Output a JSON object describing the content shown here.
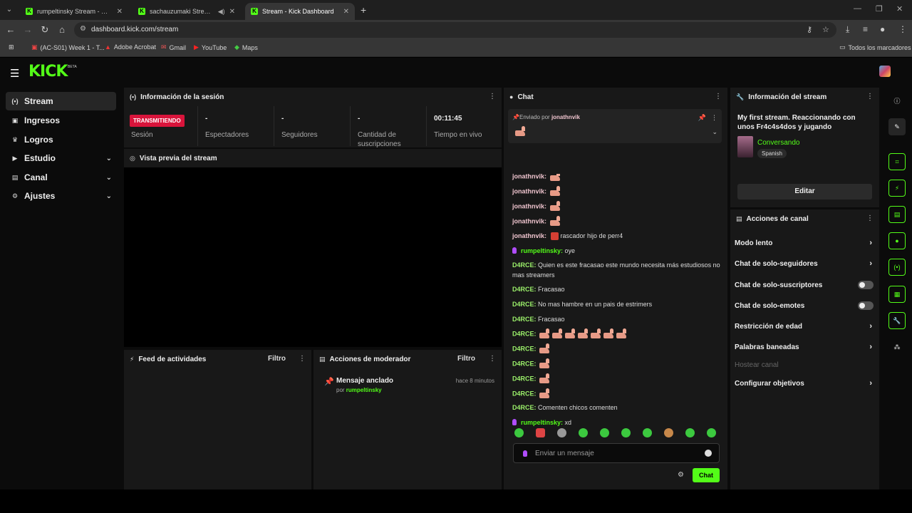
{
  "browser": {
    "tabs": [
      {
        "title": "rumpeltinsky Stream - Watch Li",
        "active": false
      },
      {
        "title": "sachauzumaki Stream - Wat",
        "active": false
      },
      {
        "title": "Stream - Kick Dashboard",
        "active": true
      }
    ],
    "url": "dashboard.kick.com/stream",
    "bookmarks": [
      "(AC-S01) Week 1 - T...",
      "Adobe Acrobat",
      "Gmail",
      "YouTube",
      "Maps"
    ],
    "all_bookmarks": "Todos los marcadores"
  },
  "app": {
    "logo": "KICK",
    "beta": "BETA",
    "sidebar": [
      {
        "label": "Stream",
        "icon": "broadcast-icon",
        "active": true,
        "chevron": false
      },
      {
        "label": "Ingresos",
        "icon": "wallet-icon",
        "active": false,
        "chevron": false
      },
      {
        "label": "Logros",
        "icon": "trophy-icon",
        "active": false,
        "chevron": false
      },
      {
        "label": "Estudio",
        "icon": "camera-icon",
        "active": false,
        "chevron": true
      },
      {
        "label": "Canal",
        "icon": "channel-icon",
        "active": false,
        "chevron": true
      },
      {
        "label": "Ajustes",
        "icon": "gear-icon",
        "active": false,
        "chevron": true
      }
    ],
    "session": {
      "title": "Información de la sesión",
      "live_badge": "TRANSMITIENDO",
      "session_label": "Sesión",
      "stats": [
        {
          "value": "-",
          "label": "Espectadores"
        },
        {
          "value": "-",
          "label": "Seguidores"
        },
        {
          "value": "-",
          "label": "Cantidad de suscripciones"
        },
        {
          "value": "00:11:45",
          "label": "Tiempo en vivo"
        }
      ]
    },
    "preview": {
      "title": "Vista previa del stream"
    },
    "activity": {
      "title": "Feed de actividades",
      "filter": "Filtro"
    },
    "mod": {
      "title": "Acciones de moderador",
      "filter": "Filtro",
      "item_title": "Mensaje anclado",
      "item_by_prefix": "por",
      "item_by_user": "rumpeltinsky",
      "item_time": "hace 8 minutos"
    },
    "chat": {
      "title": "Chat",
      "pinned_prefix": "Enviado por",
      "pinned_user": "jonathnvik",
      "messages": [
        {
          "user": "jonathnvik:",
          "text": "",
          "emotes": 1,
          "color": "pink"
        },
        {
          "user": "jonathnvik:",
          "text": "",
          "emotes": 1,
          "color": "pink"
        },
        {
          "user": "jonathnvik:",
          "text": "",
          "emotes": 1,
          "color": "pink"
        },
        {
          "user": "jonathnvik:",
          "text": "",
          "emotes": 1,
          "color": "pink"
        },
        {
          "user": "jonathnvik:",
          "text": "rascador hijo de perr4",
          "emotes": 0,
          "angry": true,
          "color": "pink"
        },
        {
          "user": "rumpeltinsky:",
          "text": "oye",
          "emotes": 0,
          "mic": true,
          "color": "green"
        },
        {
          "user": "D4RCE:",
          "text": "Quien es este fracasao este mundo necesita más estudiosos no mas streamers",
          "emotes": 0,
          "color": "lime"
        },
        {
          "user": "D4RCE:",
          "text": "Fracasao",
          "emotes": 0,
          "color": "lime"
        },
        {
          "user": "D4RCE:",
          "text": "No mas hambre en un pais de estrimers",
          "emotes": 0,
          "color": "lime"
        },
        {
          "user": "D4RCE:",
          "text": "Fracasao",
          "emotes": 0,
          "color": "lime"
        },
        {
          "user": "D4RCE:",
          "text": "",
          "emotes": 7,
          "color": "lime"
        },
        {
          "user": "D4RCE:",
          "text": "",
          "emotes": 1,
          "color": "lime"
        },
        {
          "user": "D4RCE:",
          "text": "",
          "emotes": 1,
          "color": "lime"
        },
        {
          "user": "D4RCE:",
          "text": "",
          "emotes": 1,
          "color": "lime"
        },
        {
          "user": "D4RCE:",
          "text": "",
          "emotes": 1,
          "color": "lime"
        },
        {
          "user": "D4RCE:",
          "text": "Comenten chicos comenten",
          "emotes": 0,
          "color": "lime"
        },
        {
          "user": "rumpeltinsky:",
          "text": "xd",
          "emotes": 0,
          "mic": true,
          "color": "green"
        }
      ],
      "input_placeholder": "Enviar un mensaje",
      "send_label": "Chat"
    },
    "stream_info": {
      "title": "Información del stream",
      "stream_title": "My first stream. Reaccionando con unos Fr4c4s4dos y jugando",
      "category": "Conversando",
      "language": "Spanish",
      "edit_label": "Editar"
    },
    "channel_actions": {
      "title": "Acciones de canal",
      "items": [
        {
          "label": "Modo lento",
          "kind": "arrow"
        },
        {
          "label": "Chat de solo-seguidores",
          "kind": "arrow"
        },
        {
          "label": "Chat de solo-suscriptores",
          "kind": "toggle",
          "on": false
        },
        {
          "label": "Chat de solo-emotes",
          "kind": "toggle",
          "on": false
        },
        {
          "label": "Restricción de edad",
          "kind": "arrow"
        },
        {
          "label": "Palabras baneadas",
          "kind": "arrow"
        },
        {
          "label": "Hostear canal",
          "kind": "disabled"
        },
        {
          "label": "Configurar objetivos",
          "kind": "arrow"
        }
      ]
    },
    "colors": {
      "brand": "#53fc18",
      "live": "#d9143b",
      "panel": "#181818",
      "bg": "#0b0b0b"
    }
  }
}
